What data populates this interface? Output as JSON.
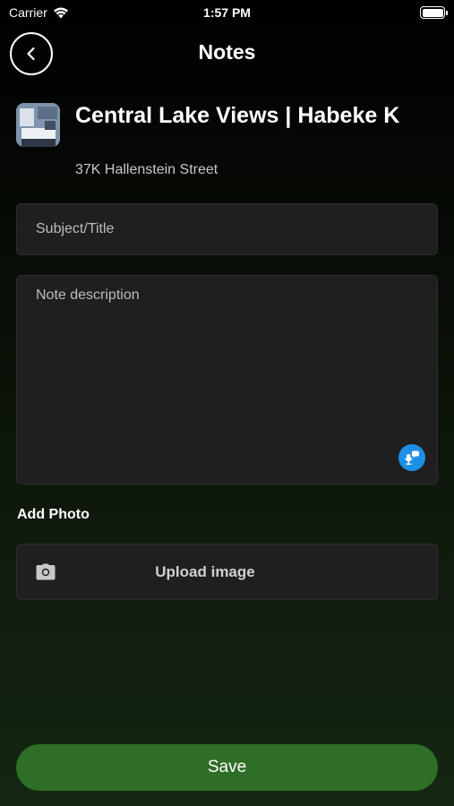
{
  "status_bar": {
    "carrier": "Carrier",
    "time": "1:57 PM"
  },
  "header": {
    "back_icon": "chevron-left-icon",
    "title": "Notes"
  },
  "property": {
    "name": "Central Lake Views | Habeke K",
    "address": "37K Hallenstein Street"
  },
  "form": {
    "subject_placeholder": "Subject/Title",
    "description_placeholder": "Note description",
    "mic_icon": "microphone-icon",
    "add_photo_label": "Add Photo",
    "upload_label": "Upload image",
    "camera_icon": "camera-icon",
    "save_label": "Save"
  },
  "colors": {
    "accent_green": "#2e6e27",
    "mic_blue": "#1e8fe6",
    "field_bg": "#1f1f1f"
  }
}
